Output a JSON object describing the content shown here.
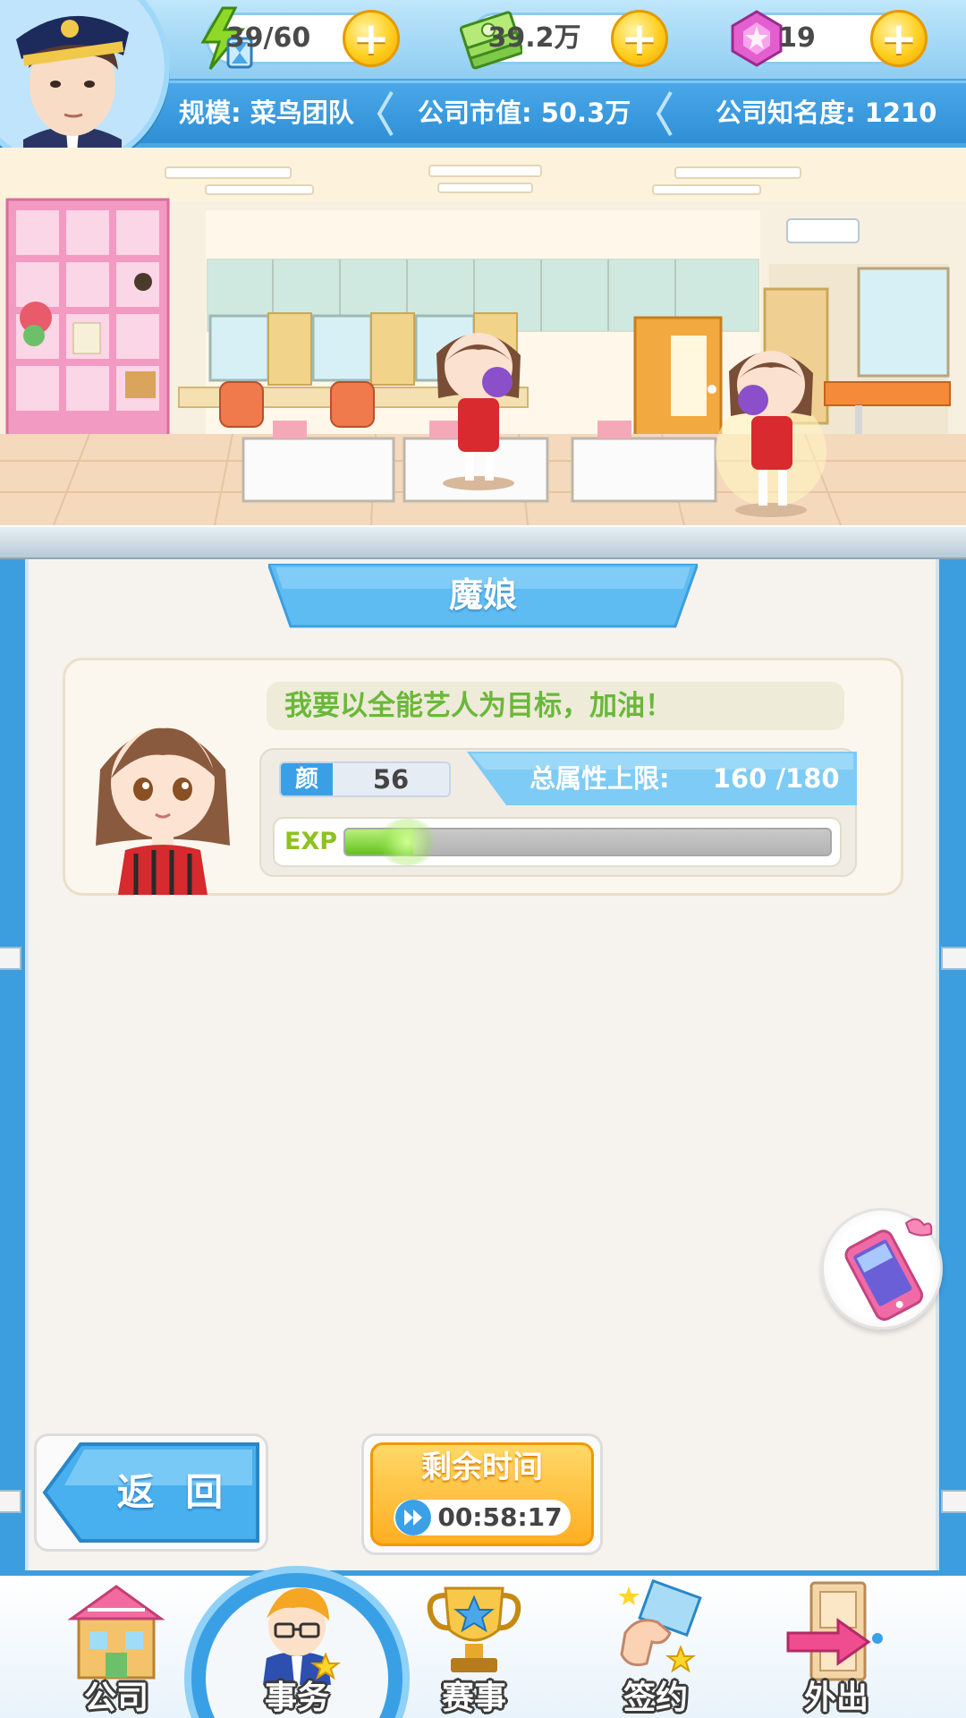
{
  "resources": {
    "energy": {
      "value": "39/60",
      "icon": "energy-hourglass-icon"
    },
    "money": {
      "value": "39.2万",
      "icon": "cash-stack-icon"
    },
    "gems": {
      "value": "19",
      "icon": "pink-gem-icon"
    }
  },
  "company": {
    "scale": "规模: 菜鸟团队",
    "market_value": "公司市值: 50.3万",
    "fame": "公司知名度: 1210"
  },
  "artist": {
    "name": "魔娘",
    "quote": "我要以全能艺人为目标，加油！",
    "stat_key": "颜",
    "stat_value": "56",
    "cap_label": "总属性上限:",
    "cap_value": "160 /180",
    "exp_label": "EXP",
    "exp_progress": 0.14
  },
  "buttons": {
    "back": "返 回",
    "time_title": "剩余时间",
    "time_value": "00:58:17"
  },
  "nav": {
    "items": [
      {
        "label": "公司",
        "icon": "company-building-icon",
        "active": false
      },
      {
        "label": "事务",
        "icon": "manager-avatar-icon",
        "active": true
      },
      {
        "label": "赛事",
        "icon": "trophy-icon",
        "active": false
      },
      {
        "label": "签约",
        "icon": "contract-hand-icon",
        "active": false
      },
      {
        "label": "外出",
        "icon": "door-exit-icon",
        "active": false
      }
    ]
  },
  "colors": {
    "accent_blue": "#3c9ede",
    "gold": "#ffc21f",
    "exp_green": "#62c21f",
    "quote_green": "#6ab83a"
  }
}
